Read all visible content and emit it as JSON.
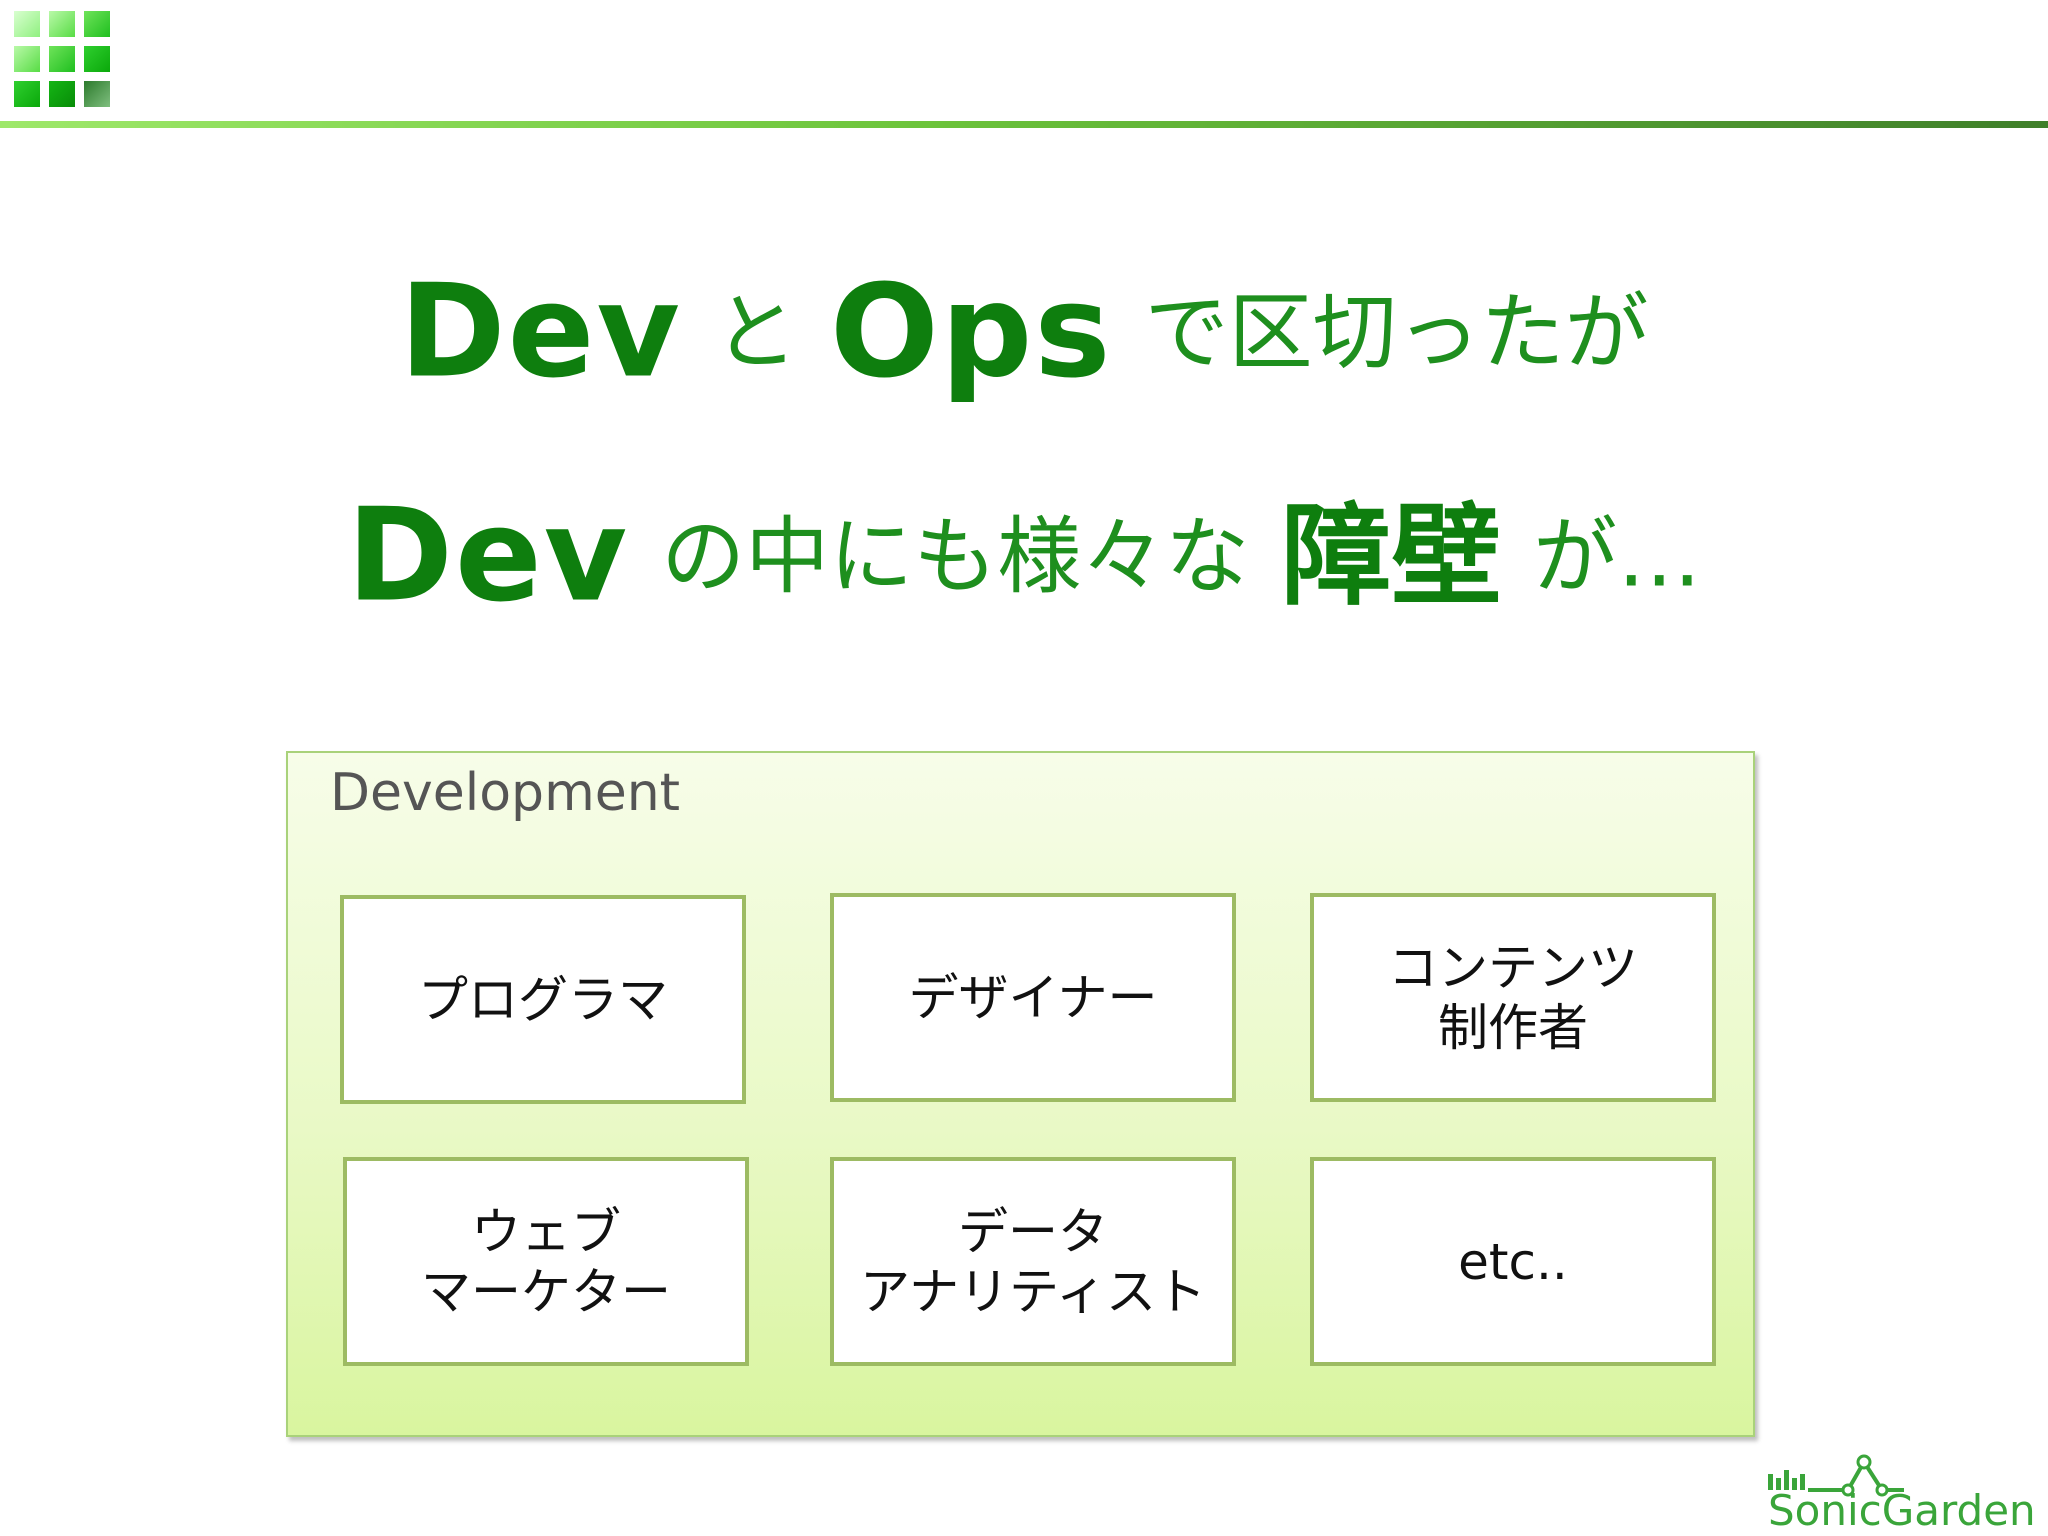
{
  "headline": {
    "line1": {
      "word1": "Dev",
      "conj": "と",
      "word2": "Ops",
      "rest": "で区切ったが"
    },
    "line2": {
      "word1": "Dev",
      "middle": "の中にも様々な",
      "emphasis": "障壁",
      "rest": "が…"
    }
  },
  "panel": {
    "title": "Development",
    "roles": [
      "プログラマ",
      "デザイナー",
      "コンテンツ\n制作者",
      "ウェブ\nマーケター",
      "データ\nアナリティスト",
      "etc.."
    ]
  },
  "logo": {
    "name": "SonicGarden",
    "icon": "grid-logo-icon"
  },
  "colors": {
    "headline_green": "#0e7e0e",
    "rule_start": "#9ee86a",
    "rule_end": "#3f7f2a",
    "box_border": "#9dbb63"
  }
}
